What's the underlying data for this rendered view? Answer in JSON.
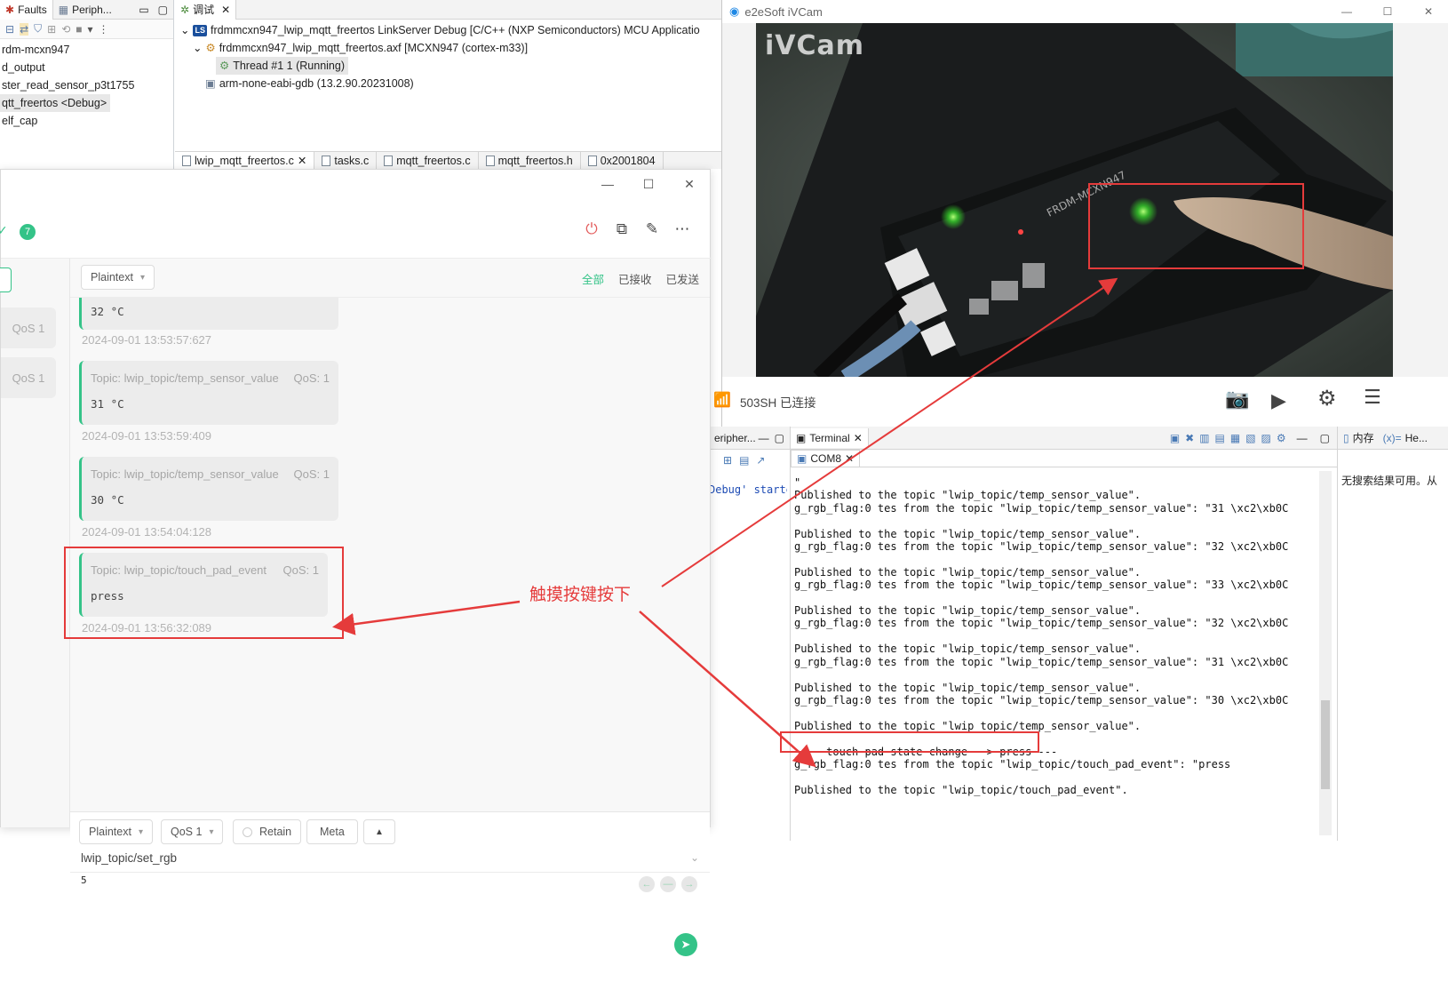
{
  "ide": {
    "left_tabs": [
      "Faults",
      "Periph..."
    ],
    "project_tree": [
      "rdm-mcxn947",
      "d_output",
      "ster_read_sensor_p3t1755",
      "qtt_freertos <Debug>",
      "elf_cap"
    ],
    "debug_tab": "调试",
    "debug_tree": {
      "launch": "frdmmcxn947_lwip_mqtt_freertos LinkServer Debug [C/C++ (NXP Semiconductors) MCU Applicatio",
      "axf": "frdmmcxn947_lwip_mqtt_freertos.axf [MCXN947 (cortex-m33)]",
      "thread": "Thread #1 1 (Running)",
      "gdb": "arm-none-eabi-gdb (13.2.90.20231008)"
    },
    "ls_badge": "LS",
    "editor_tabs": [
      "lwip_mqtt_freertos.c",
      "tasks.c",
      "mqtt_freertos.c",
      "mqtt_freertos.h",
      "0x2001804"
    ]
  },
  "mqttx": {
    "unread_count": "7",
    "filter": {
      "format": "Plaintext",
      "tabs": [
        "全部",
        "已接收",
        "已发送"
      ]
    },
    "left_qos": [
      "QoS 1",
      "QoS 1"
    ],
    "messages": [
      {
        "topic": "",
        "qos": "",
        "payload": "32 °C",
        "time": "2024-09-01 13:53:57:627"
      },
      {
        "topic": "Topic: lwip_topic/temp_sensor_value",
        "qos": "QoS: 1",
        "payload": "31 °C",
        "time": "2024-09-01 13:53:59:409"
      },
      {
        "topic": "Topic: lwip_topic/temp_sensor_value",
        "qos": "QoS: 1",
        "payload": "30 °C",
        "time": "2024-09-01 13:54:04:128"
      },
      {
        "topic": "Topic: lwip_topic/touch_pad_event",
        "qos": "QoS: 1",
        "payload": "press",
        "time": "2024-09-01 13:56:32:089"
      }
    ],
    "compose": {
      "format": "Plaintext",
      "qos": "QoS 1",
      "retain": "Retain",
      "meta": "Meta",
      "topic": "lwip_topic/set_rgb",
      "payload": "5"
    }
  },
  "annotation": {
    "label": "触摸按键按下",
    "color": "#e53b3b"
  },
  "ivcam": {
    "title": "e2eSoft iVCam",
    "watermark": "iVCam",
    "board_label": "FRDM-MCXN947",
    "wifi_status": "503SH 已连接"
  },
  "bottom_left": {
    "tab": "eripher...",
    "text": "Debug' startec"
  },
  "terminal": {
    "tab": "Terminal",
    "subtab": "COM8",
    "lines": [
      "\"",
      "Published to the topic \"lwip_topic/temp_sensor_value\".",
      "g_rgb_flag:0 tes from the topic \"lwip_topic/temp_sensor_value\": \"31 \\xc2\\xb0C",
      "",
      "Published to the topic \"lwip_topic/temp_sensor_value\".",
      "g_rgb_flag:0 tes from the topic \"lwip_topic/temp_sensor_value\": \"32 \\xc2\\xb0C",
      "",
      "Published to the topic \"lwip_topic/temp_sensor_value\".",
      "g_rgb_flag:0 tes from the topic \"lwip_topic/temp_sensor_value\": \"33 \\xc2\\xb0C",
      "",
      "Published to the topic \"lwip_topic/temp_sensor_value\".",
      "g_rgb_flag:0 tes from the topic \"lwip_topic/temp_sensor_value\": \"32 \\xc2\\xb0C",
      "",
      "Published to the topic \"lwip_topic/temp_sensor_value\".",
      "g_rgb_flag:0 tes from the topic \"lwip_topic/temp_sensor_value\": \"31 \\xc2\\xb0C",
      "",
      "Published to the topic \"lwip_topic/temp_sensor_value\".",
      "g_rgb_flag:0 tes from the topic \"lwip_topic/temp_sensor_value\": \"30 \\xc2\\xb0C",
      "",
      "Published to the topic \"lwip_topic/temp_sensor_value\".",
      "",
      " --- touch pad state change --> press ---",
      "g_rgb_flag:0 tes from the topic \"lwip_topic/touch_pad_event\": \"press",
      "",
      "Published to the topic \"lwip_topic/touch_pad_event\"."
    ]
  },
  "right_panel": {
    "tabs": [
      "内存",
      "He..."
    ],
    "text": "无搜索结果可用。从"
  }
}
